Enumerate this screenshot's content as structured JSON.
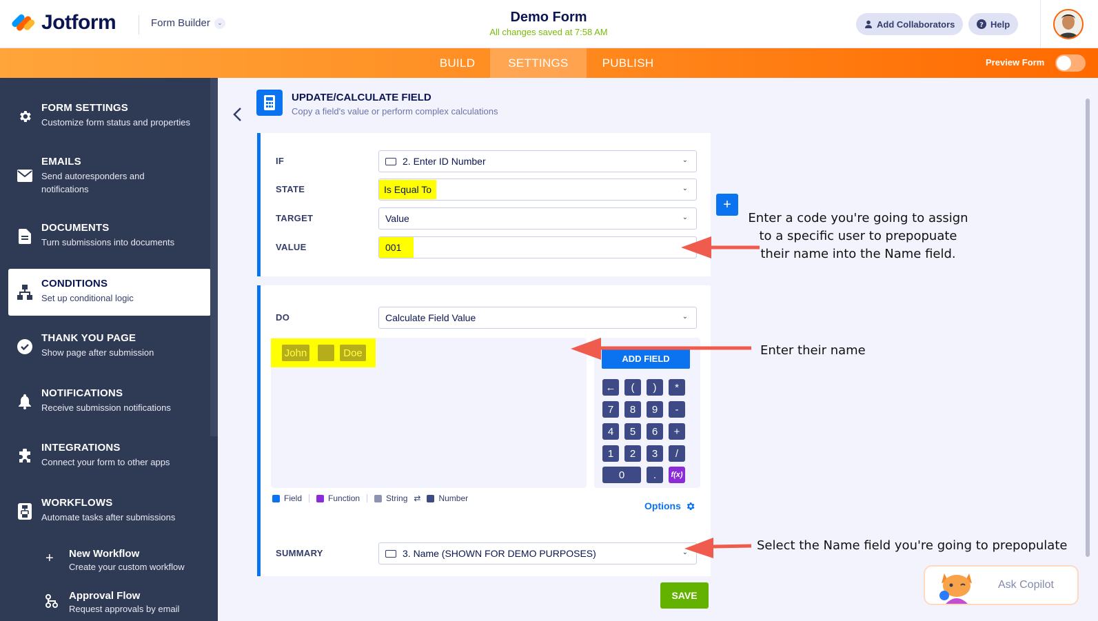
{
  "header": {
    "logo_text": "Jotform",
    "builder_label": "Form Builder",
    "form_title": "Demo Form",
    "save_status": "All changes saved at 7:58 AM",
    "add_collaborators": "Add Collaborators",
    "help": "Help"
  },
  "nav": {
    "tabs": [
      {
        "label": "BUILD",
        "active": false
      },
      {
        "label": "SETTINGS",
        "active": true
      },
      {
        "label": "PUBLISH",
        "active": false
      }
    ],
    "preview_label": "Preview Form",
    "preview_on": false
  },
  "sidebar": {
    "items": [
      {
        "title": "FORM SETTINGS",
        "desc": "Customize form status and properties",
        "icon": "gear-icon"
      },
      {
        "title": "EMAILS",
        "desc": "Send autoresponders and notifications",
        "icon": "envelope-icon"
      },
      {
        "title": "DOCUMENTS",
        "desc": "Turn submissions into documents",
        "icon": "document-icon"
      },
      {
        "title": "CONDITIONS",
        "desc": "Set up conditional logic",
        "icon": "conditions-icon",
        "active": true
      },
      {
        "title": "THANK YOU PAGE",
        "desc": "Show page after submission",
        "icon": "check-circle-icon"
      },
      {
        "title": "NOTIFICATIONS",
        "desc": "Receive submission notifications",
        "icon": "bell-icon"
      },
      {
        "title": "INTEGRATIONS",
        "desc": "Connect your form to other apps",
        "icon": "puzzle-icon"
      },
      {
        "title": "WORKFLOWS",
        "desc": "Automate tasks after submissions",
        "icon": "workflow-icon"
      }
    ],
    "subitems": [
      {
        "title": "New Workflow",
        "desc": "Create your custom workflow",
        "icon": "plus-icon"
      },
      {
        "title": "Approval Flow",
        "desc": "Request approvals by email",
        "icon": "approval-flow-icon"
      }
    ]
  },
  "panel": {
    "title": "UPDATE/CALCULATE FIELD",
    "subtitle": "Copy a field's value or perform complex calculations"
  },
  "condition": {
    "if_label": "IF",
    "if_value": "2. Enter ID Number",
    "state_label": "STATE",
    "state_value": "Is Equal To",
    "target_label": "TARGET",
    "target_value": "Value",
    "value_label": "VALUE",
    "value_value": "001"
  },
  "action": {
    "do_label": "DO",
    "do_value": "Calculate Field Value",
    "tokens": [
      "John",
      "",
      "Doe"
    ],
    "add_field": "ADD FIELD",
    "keys": [
      "←",
      "(",
      ")",
      "*",
      "7",
      "8",
      "9",
      "-",
      "4",
      "5",
      "6",
      "+",
      "1",
      "2",
      "3",
      "/",
      "0",
      ".",
      "f(x)"
    ],
    "legend": {
      "field": "Field",
      "function": "Function",
      "string": "String",
      "swap": "⇄",
      "number": "Number"
    },
    "options": "Options",
    "summary_label": "SUMMARY",
    "summary_value": "3. Name (SHOWN FOR DEMO PURPOSES)"
  },
  "buttons": {
    "save": "SAVE",
    "add": "+"
  },
  "annotations": {
    "value_note": [
      "Enter a code you're going to assign",
      "to a specific user to prepopuate",
      "their name into the Name field."
    ],
    "name_note": "Enter their name",
    "summary_note": "Select the Name field you're going to prepopulate"
  },
  "copilot": {
    "label": "Ask Copilot"
  },
  "colors": {
    "brand_orange": "#ff6100",
    "accent_blue": "#0b73f0",
    "sidebar_bg": "#2f3a55",
    "highlight": "#ffff00",
    "save_green": "#64b200",
    "arrow_red": "#ef5b4c"
  }
}
